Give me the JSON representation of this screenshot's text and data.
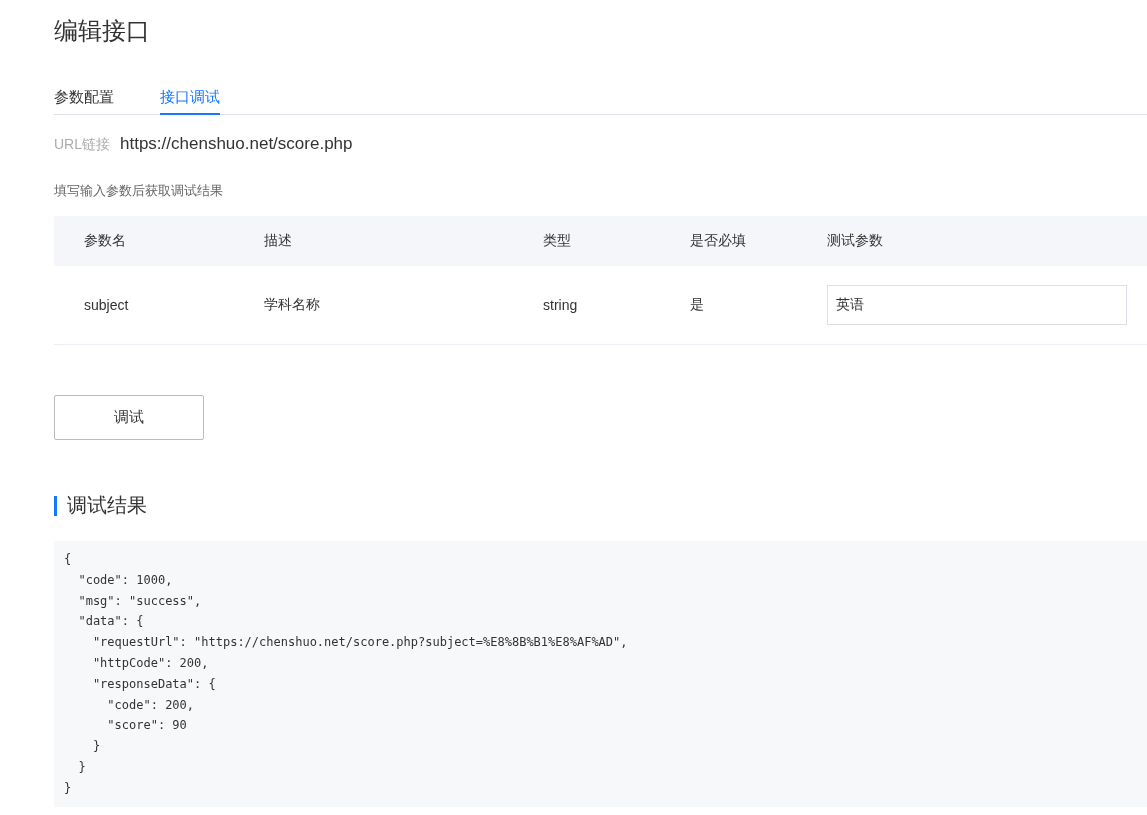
{
  "page_title": "编辑接口",
  "tabs": [
    {
      "label": "参数配置",
      "selected": false
    },
    {
      "label": "接口调试",
      "selected": true
    }
  ],
  "url": {
    "label": "URL链接",
    "value": "https://chenshuo.net/score.php"
  },
  "hint": "填写输入参数后获取调试结果",
  "table": {
    "columns": [
      "参数名",
      "描述",
      "类型",
      "是否必填",
      "测试参数"
    ],
    "rows": [
      {
        "name": "subject",
        "description": "学科名称",
        "type": "string",
        "required": "是",
        "test_value": "英语"
      }
    ]
  },
  "debug_button": "调试",
  "result": {
    "heading": "调试结果",
    "body": "{\n  \"code\": 1000,\n  \"msg\": \"success\",\n  \"data\": {\n    \"requestUrl\": \"https://chenshuo.net/score.php?subject=%E8%8B%B1%E8%AF%AD\",\n    \"httpCode\": 200,\n    \"responseData\": {\n      \"code\": 200,\n      \"score\": 90\n    }\n  }\n}"
  }
}
